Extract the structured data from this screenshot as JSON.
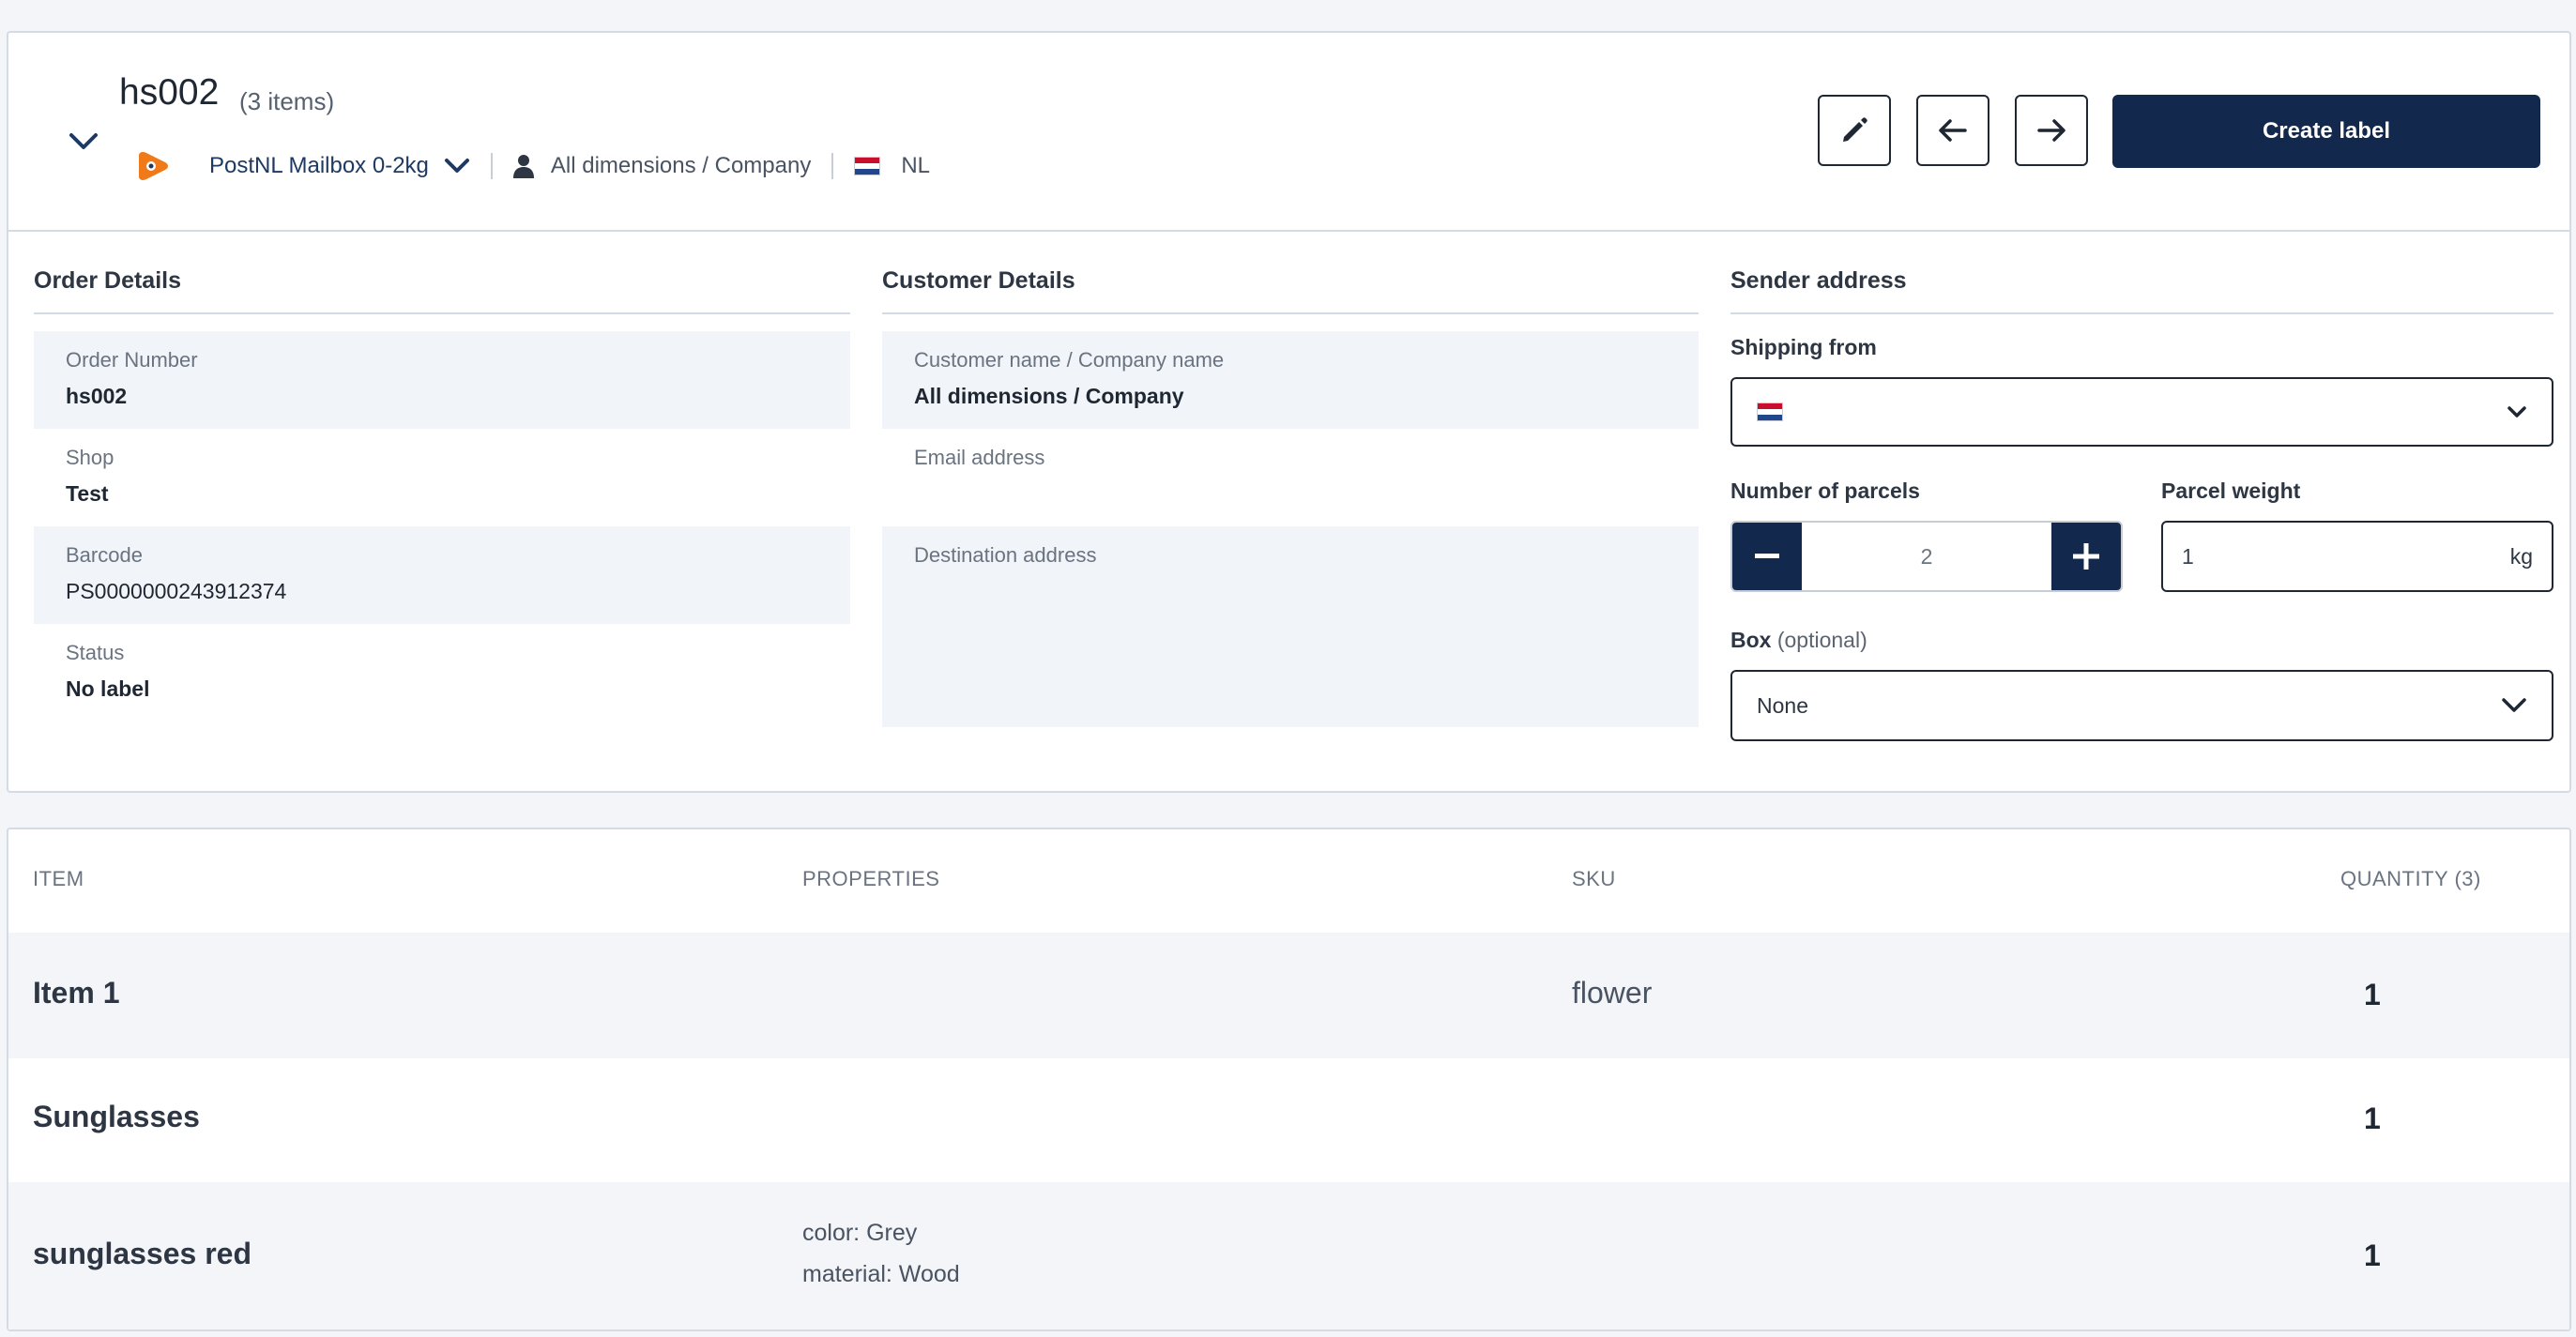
{
  "order": {
    "number": "hs002",
    "count_label": "(3 items)"
  },
  "carrier": {
    "name": "PostNL Mailbox 0-2kg",
    "customer": "All dimensions / Company",
    "country": "NL"
  },
  "actions": {
    "create_label": "Create label"
  },
  "order_details": {
    "title": "Order Details",
    "fields": [
      {
        "label": "Order Number",
        "value": "hs002"
      },
      {
        "label": "Shop",
        "value": "Test"
      },
      {
        "label": "Barcode",
        "value": "PS0000000243912374"
      },
      {
        "label": "Status",
        "value": "No label"
      }
    ]
  },
  "customer_details": {
    "title": "Customer Details",
    "fields": [
      {
        "label": "Customer name / Company name",
        "value": "All dimensions / Company"
      },
      {
        "label": "Email address",
        "value": ""
      },
      {
        "label": "Destination address",
        "value": ""
      }
    ]
  },
  "sender": {
    "title": "Sender address",
    "shipping_from_label": "Shipping from",
    "parcels_label": "Number of parcels",
    "parcels_value": "2",
    "weight_label": "Parcel weight",
    "weight_value": "1",
    "weight_unit": "kg",
    "box_label": "Box",
    "box_optional": "(optional)",
    "box_value": "None"
  },
  "table": {
    "headers": {
      "item": "ITEM",
      "properties": "PROPERTIES",
      "sku": "SKU",
      "quantity": "QUANTITY (3)"
    },
    "rows": [
      {
        "name": "Item 1",
        "props": [
          "",
          ""
        ],
        "sku": "flower",
        "qty": "1"
      },
      {
        "name": "Sunglasses",
        "props": [
          "",
          ""
        ],
        "sku": "",
        "qty": "1"
      },
      {
        "name": "sunglasses red",
        "props": [
          "color: Grey",
          "material: Wood"
        ],
        "sku": "",
        "qty": "1"
      }
    ]
  },
  "colors": {
    "primary": "#13284d",
    "link": "#1e3a63",
    "carrier_logo": "#f07a1a"
  }
}
